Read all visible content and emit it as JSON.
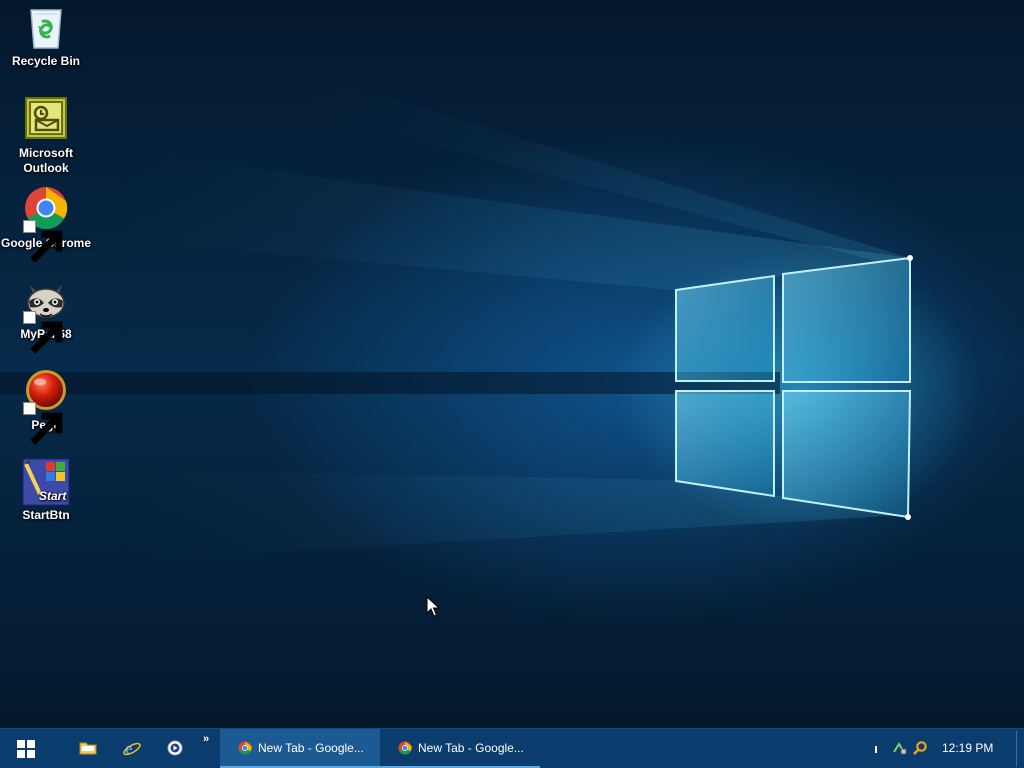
{
  "desktop_icons": [
    {
      "label": "Recycle Bin",
      "icon": "recycle-bin-icon"
    },
    {
      "label": "Microsoft Outlook",
      "icon": "outlook-icon"
    },
    {
      "label": "Google Chrome",
      "icon": "chrome-icon"
    },
    {
      "label": "MyPal 68",
      "icon": "mypal-raccoon-icon"
    },
    {
      "label": "Pego",
      "icon": "pego-red-ball-icon"
    },
    {
      "label": "StartBtn",
      "icon": "startbtn-icon"
    }
  ],
  "startbtn_icon_text": "Start",
  "taskbar": {
    "start_icon": "windows-logo-icon",
    "quick_launch": [
      "file-explorer-icon",
      "internet-explorer-icon",
      "media-player-icon"
    ],
    "overflow": "»",
    "tasks": [
      {
        "label": "New Tab - Google...",
        "icon": "chrome-icon",
        "state": "active"
      },
      {
        "label": "New Tab - Google...",
        "icon": "chrome-icon",
        "state": "inactive"
      }
    ],
    "tray_icons": [
      "network-icon",
      "search-tray-icon"
    ],
    "clock": "12:19 PM"
  },
  "colors": {
    "taskbar": "#0b3c6e",
    "taskbar_active": "#1c5a94",
    "accent": "#5aa9e6",
    "desktop_glow": "#3cbeeb"
  }
}
